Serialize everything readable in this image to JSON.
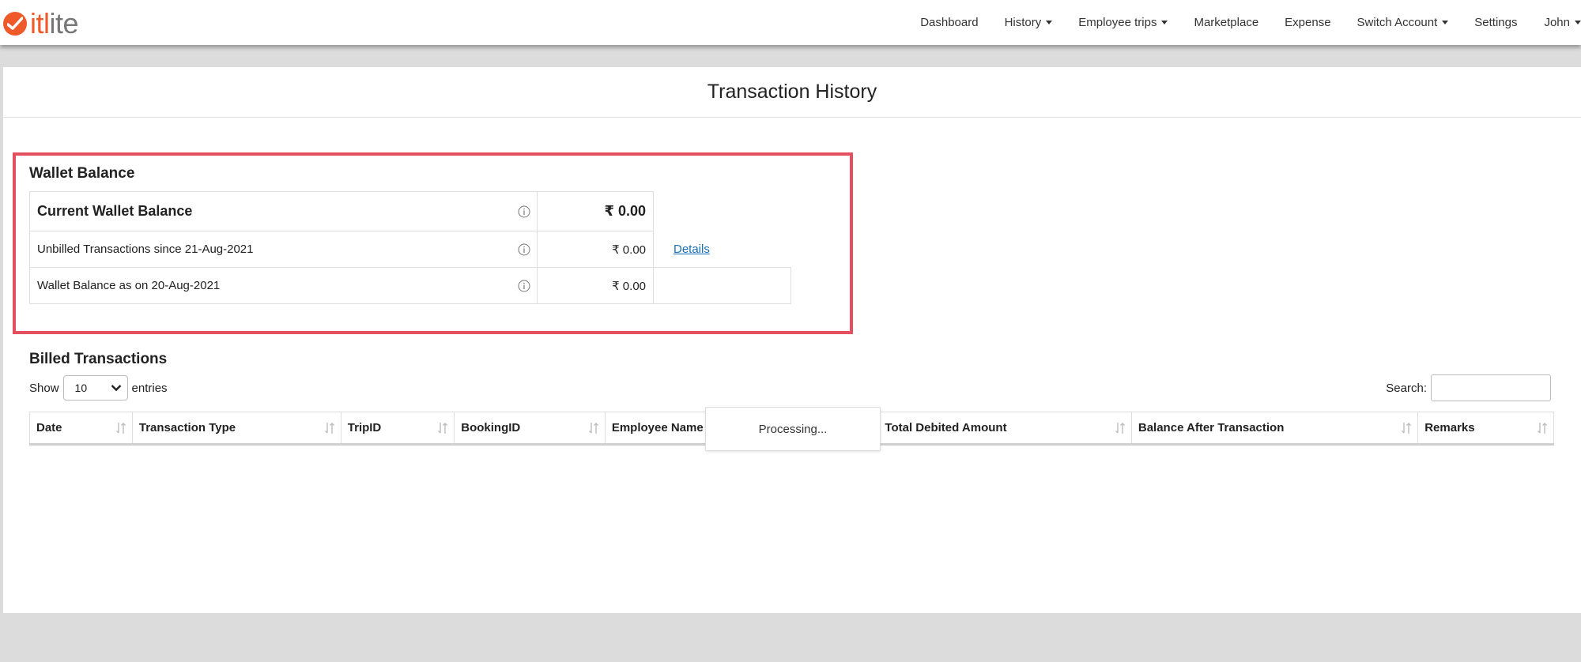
{
  "brand": {
    "logo_prefix": "itl",
    "logo_suffix": "ite",
    "accent_color": "#f0592a"
  },
  "nav": {
    "items": [
      {
        "label": "Dashboard",
        "dropdown": false
      },
      {
        "label": "History",
        "dropdown": true
      },
      {
        "label": "Employee trips",
        "dropdown": true
      },
      {
        "label": "Marketplace",
        "dropdown": false
      },
      {
        "label": "Expense",
        "dropdown": false
      },
      {
        "label": "Switch Account",
        "dropdown": true
      },
      {
        "label": "Settings",
        "dropdown": false
      },
      {
        "label": "John",
        "dropdown": true
      }
    ]
  },
  "page": {
    "title": "Transaction History"
  },
  "wallet": {
    "title": "Wallet Balance",
    "highlight_color": "#e4505f",
    "rows": [
      {
        "label": "Current Wallet Balance",
        "amount": "₹ 0.00"
      },
      {
        "label": "Unbilled Transactions since 21-Aug-2021",
        "amount": "₹ 0.00",
        "link": "Details"
      },
      {
        "label": "Wallet Balance as on 20-Aug-2021",
        "amount": "₹ 0.00"
      }
    ]
  },
  "billed": {
    "title": "Billed Transactions",
    "show_label": "Show",
    "entries_value": "10",
    "entries_label": "entries",
    "search_label": "Search:",
    "search_value": "",
    "columns": [
      "Date",
      "Transaction Type",
      "TripID",
      "BookingID",
      "Employee Name",
      "",
      "Total Debited Amount",
      "Balance After Transaction",
      "Remarks"
    ],
    "processing_text": "Processing..."
  }
}
